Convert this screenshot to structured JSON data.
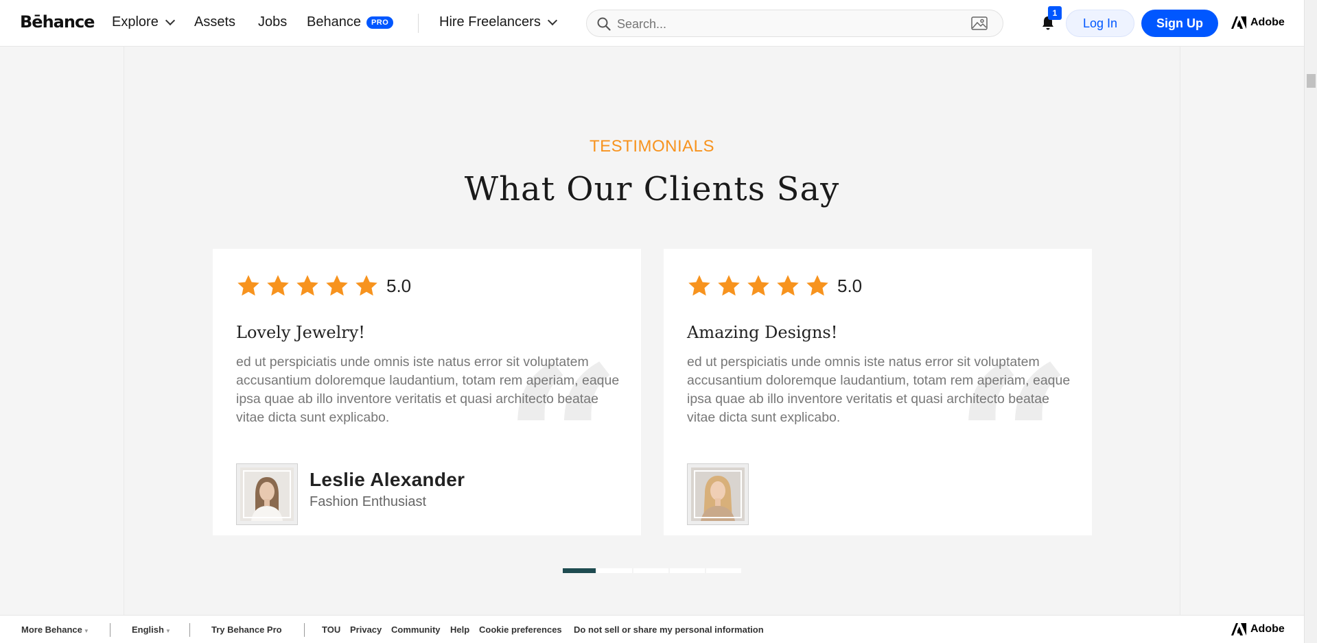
{
  "nav": {
    "logo": "Bēhance",
    "explore": "Explore",
    "assets": "Assets",
    "jobs": "Jobs",
    "behance": "Behance",
    "pro_badge": "PRO",
    "hire": "Hire Freelancers",
    "search_placeholder": "Search...",
    "notifications_count": "1",
    "login": "Log In",
    "signup": "Sign Up",
    "adobe": "Adobe"
  },
  "section": {
    "eyebrow": "TESTIMONIALS",
    "heading": "What Our Clients Say"
  },
  "testimonials": [
    {
      "rating": "5.0",
      "stars": 5,
      "title": "Lovely Jewelry!",
      "text": "ed ut perspiciatis unde omnis iste natus error sit voluptatem accusantium doloremque laudantium, totam rem aperiam, eaque ipsa quae ab illo inventore veritatis et quasi architecto beatae vitae dicta sunt explicabo.",
      "author": "Leslie Alexander",
      "role": "Fashion Enthusiast"
    },
    {
      "rating": "5.0",
      "stars": 5,
      "title": "Amazing Designs!",
      "text": "ed ut perspiciatis unde omnis iste natus error sit voluptatem accusantium doloremque laudantium, totam rem aperiam, eaque ipsa quae ab illo inventore veritatis et quasi architecto beatae vitae dicta sunt explicabo.",
      "author": "",
      "role": ""
    }
  ],
  "carousel": {
    "total_dots": 5,
    "active_index": 0
  },
  "footer": {
    "more_behance": "More Behance",
    "language": "English",
    "try_pro": "Try Behance Pro",
    "tou": "TOU",
    "privacy": "Privacy",
    "community": "Community",
    "help": "Help",
    "cookie": "Cookie preferences",
    "do_not_sell": "Do not sell or share my personal information",
    "adobe": "Adobe"
  },
  "colors": {
    "accent_orange": "#f7931e",
    "brand_blue": "#0057ff",
    "active_dot": "#1e4b50",
    "star": "#f7931e"
  },
  "icons": [
    "search-icon",
    "image-search-icon",
    "bell-icon",
    "adobe-logo-icon",
    "star-icon",
    "quote-icon",
    "chevron-down-icon"
  ]
}
